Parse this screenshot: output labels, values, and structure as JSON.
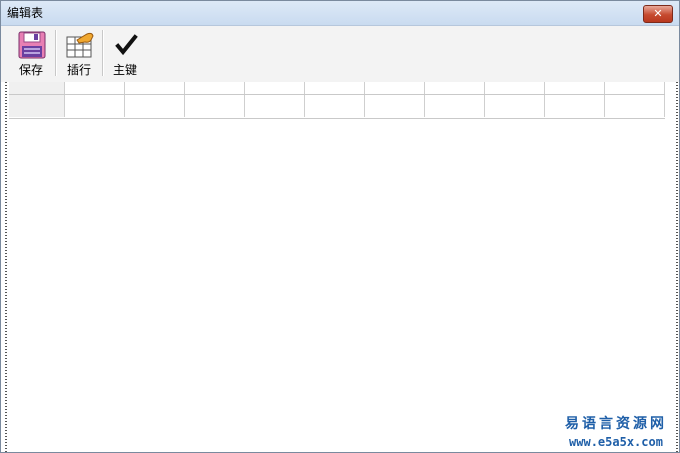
{
  "window": {
    "title": "编辑表",
    "close_glyph": "✕"
  },
  "toolbar": {
    "buttons": [
      {
        "label": "保存",
        "icon": "save-disk-icon"
      },
      {
        "label": "插行",
        "icon": "insert-row-icon"
      },
      {
        "label": "主键",
        "icon": "checkmark-icon"
      }
    ]
  },
  "grid": {
    "columns": 11,
    "rows": 1
  },
  "watermark": {
    "line1": "易语言资源网",
    "line2": "www.e5a5x.com"
  },
  "colors": {
    "close_red": "#c64a2f",
    "watermark_blue": "#1f5fa8",
    "save_pink": "#e87fb4",
    "save_purple": "#6a3fa0"
  }
}
